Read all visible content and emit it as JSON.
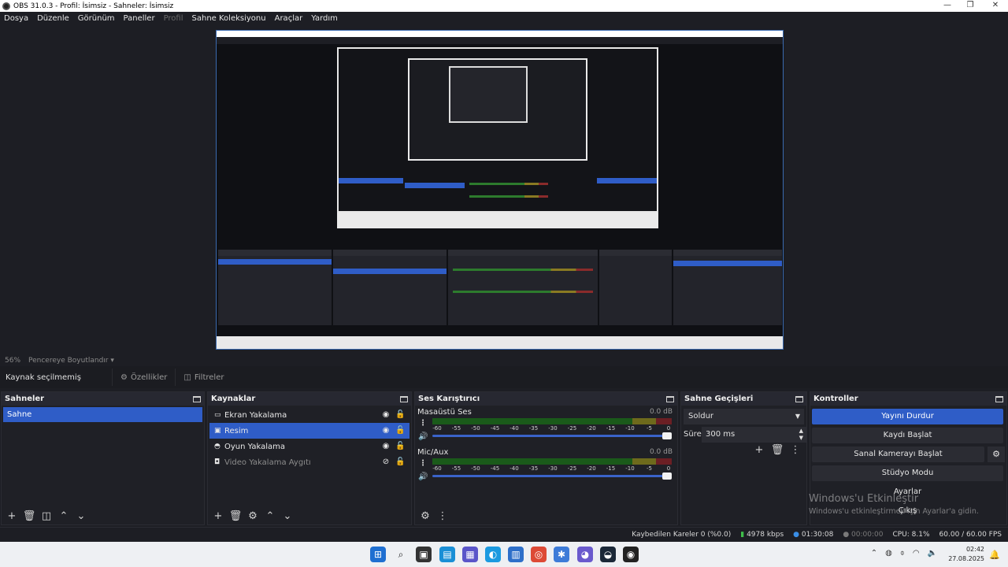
{
  "window": {
    "title": "OBS 31.0.3 - Profil: İsimsiz - Sahneler: İsimsiz",
    "minimize": "—",
    "maximize": "❐",
    "close": "✕"
  },
  "menu": {
    "items": [
      "Dosya",
      "Düzenle",
      "Görünüm",
      "Paneller",
      "Profil",
      "Sahne Koleksiyonu",
      "Araçlar",
      "Yardım"
    ]
  },
  "preview": {
    "zoom": "56%",
    "scale_mode": "Pencereye Boyutlandır"
  },
  "source_toolbar": {
    "status": "Kaynak seçilmemiş",
    "properties": "Özellikler",
    "filters": "Filtreler"
  },
  "scenes": {
    "title": "Sahneler",
    "items": [
      "Sahne"
    ]
  },
  "sources": {
    "title": "Kaynaklar",
    "items": [
      {
        "name": "Ekran Yakalama",
        "icon": "monitor-icon"
      },
      {
        "name": "Resim",
        "icon": "image-icon"
      },
      {
        "name": "Oyun Yakalama",
        "icon": "gamepad-icon"
      },
      {
        "name": "Video Yakalama Aygıtı",
        "icon": "camera-icon"
      }
    ]
  },
  "mixer": {
    "title": "Ses Karıştırıcı",
    "channels": [
      {
        "name": "Masaüstü Ses",
        "db": "0.0 dB",
        "level": 1.0
      },
      {
        "name": "Mic/Aux",
        "db": "0.0 dB",
        "level": 1.0
      }
    ],
    "ticks": [
      "-60",
      "-55",
      "-50",
      "-45",
      "-40",
      "-35",
      "-30",
      "-25",
      "-20",
      "-15",
      "-10",
      "-5",
      "0"
    ]
  },
  "transitions": {
    "title": "Sahne Geçişleri",
    "selected": "Soldur",
    "duration_label": "Süre",
    "duration_value": "300 ms"
  },
  "controls": {
    "title": "Kontroller",
    "stop_stream": "Yayını Durdur",
    "start_record": "Kaydı Başlat",
    "virtual_cam": "Sanal Kamerayı Başlat",
    "studio_mode": "Stüdyo Modu",
    "settings": "Ayarlar",
    "exit": "Çıkış"
  },
  "watermark": {
    "line1": "Windows'u Etkinleştir",
    "line2": "Windows'u etkinleştirmek için Ayarlar'a gidin."
  },
  "status": {
    "dropped": "Kaybedilen Kareler 0 (%0.0)",
    "bitrate": "4978 kbps",
    "live_time": "01:30:08",
    "rec_time": "00:00:00",
    "cpu": "CPU: 8.1%",
    "fps": "60.00 / 60.00 FPS"
  },
  "taskbar": {
    "time": "02:42",
    "date": "27.08.2025"
  },
  "colors": {
    "accent": "#2f5dc7",
    "panel": "#1f2026",
    "background": "#1d1e24"
  }
}
